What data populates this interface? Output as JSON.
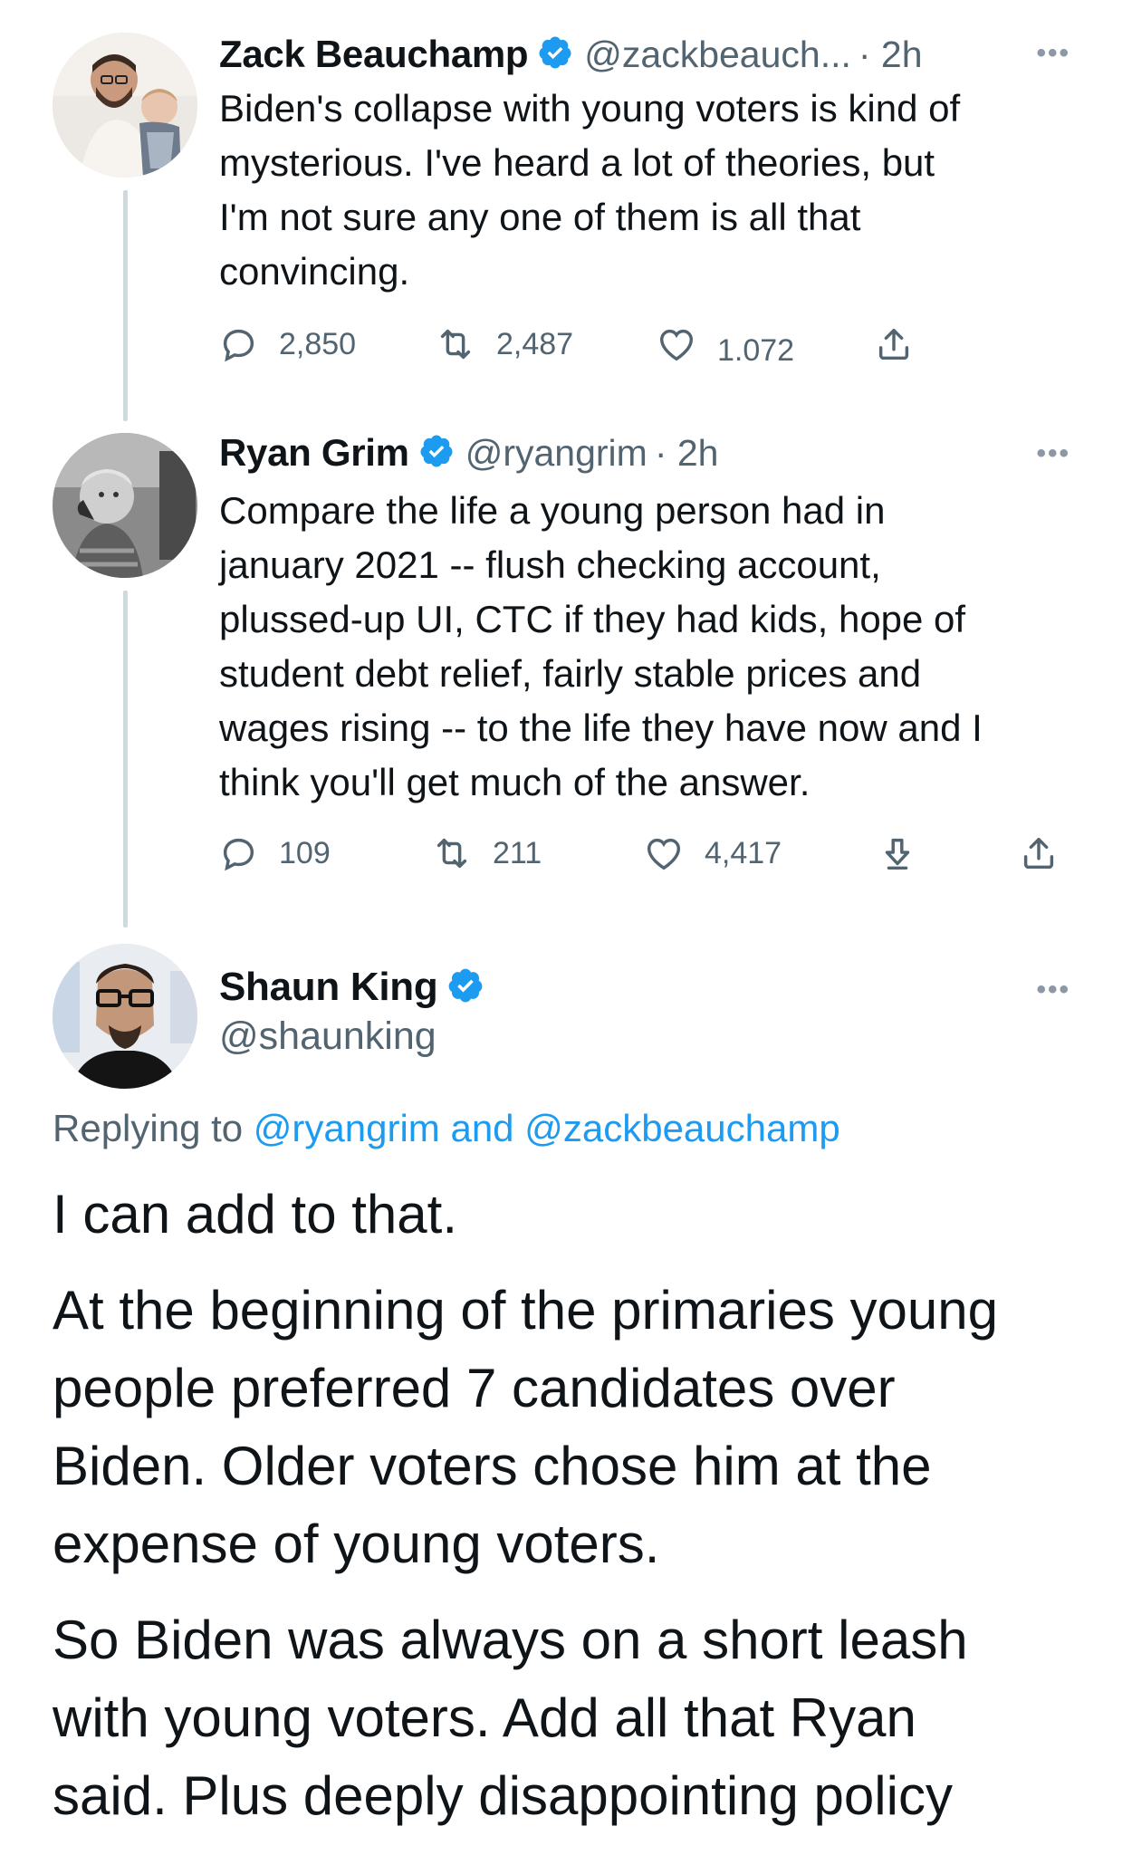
{
  "tweets": [
    {
      "name": "Zack Beauchamp",
      "handle": "@zackbeauch...",
      "time": "· 2h",
      "more": "•••",
      "lines": [
        "Biden's collapse with young voters is kind of",
        "mysterious. I've heard a lot of theories, but",
        "I'm not sure any one of them is all that",
        "convincing."
      ],
      "replies": "2,850",
      "retweets": "2,487",
      "likes": "1.072"
    },
    {
      "name": "Ryan Grim",
      "handle": "@ryangrim",
      "time": "· 2h",
      "more": "•••",
      "lines": [
        "Compare the life a young person had in",
        "january 2021 -- flush checking account,",
        "plussed-up UI, CTC if they had kids, hope of",
        "student debt relief, fairly stable prices and",
        "wages rising -- to the life they have now and I",
        "think you'll get much of the answer."
      ],
      "replies": "109",
      "retweets": "211",
      "likes": "4,417"
    }
  ],
  "main": {
    "name": "Shaun King",
    "handle": "@shaunking",
    "more": "•••",
    "replying_prefix": "Replying to",
    "replying_users": "@ryangrim and @zackbeauchamp",
    "paragraphs": [
      [
        "I can add to that."
      ],
      [
        "At the beginning of the primaries young",
        "people preferred 7 candidates over",
        "Biden. Older voters chose him at the",
        "expense of young voters."
      ],
      [
        "So Biden was always on a short leash",
        "with young voters. Add all that Ryan",
        "said. Plus deeply disappointing policy"
      ]
    ]
  },
  "colors": {
    "verified": "#1d9bf0",
    "link": "#1d9bf0",
    "muted": "#536471",
    "thread_line": "#cfd9de"
  },
  "icons": [
    "reply-icon",
    "retweet-icon",
    "like-icon",
    "download-icon",
    "share-icon",
    "verified-icon",
    "more-icon"
  ]
}
